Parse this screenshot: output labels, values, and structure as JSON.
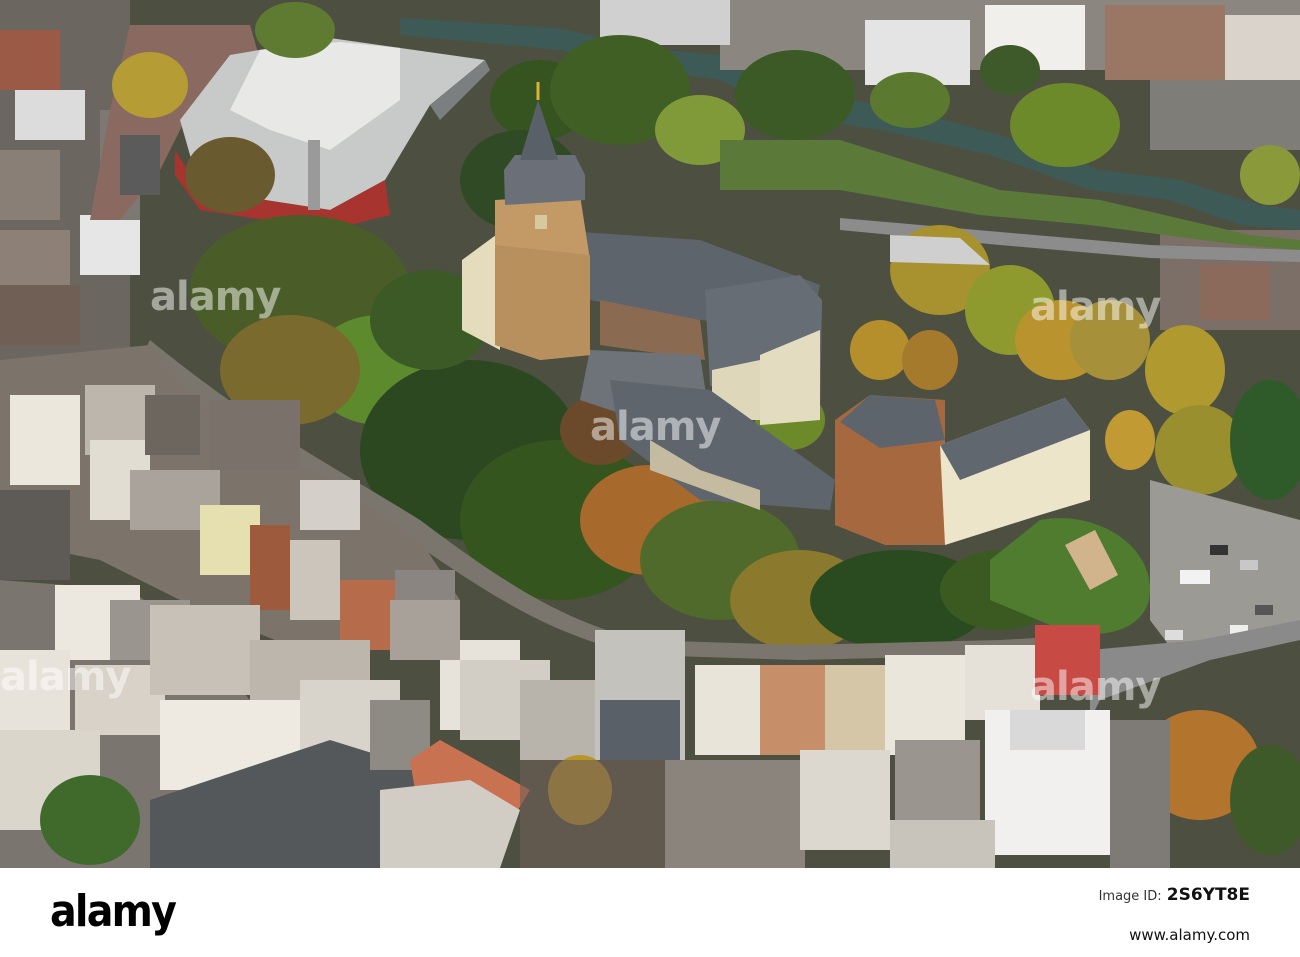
{
  "photo": {
    "subject": "Aerial view of a castle with towers surrounded by autumn trees and a town",
    "watermark_text": "alamy"
  },
  "footer": {
    "brand": "alamy",
    "image_id_label": "Image ID:",
    "image_id": "2S6YT8E",
    "url": "www.alamy.com"
  },
  "colors": {
    "foliage_dark": "#2f4a24",
    "foliage_autumn": "#b9892e",
    "roof_grey": "#5e646b",
    "facade_cream": "#e8e2c6",
    "brick": "#a5683f",
    "tower_stone": "#c39a66"
  }
}
